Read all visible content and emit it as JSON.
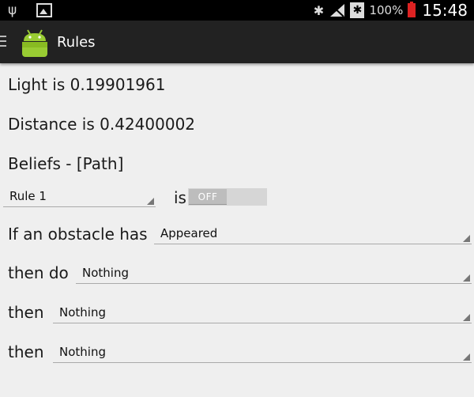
{
  "status_bar": {
    "battery_percent": "100%",
    "time": "15:48"
  },
  "action_bar": {
    "title": "Rules"
  },
  "readings": {
    "light": "Light is 0.19901961",
    "distance": "Distance is 0.42400002",
    "beliefs": "Beliefs - [Path]"
  },
  "rule": {
    "selected": "Rule 1",
    "is_label": "is",
    "toggle_label": "OFF"
  },
  "condition": {
    "label": "If an obstacle has",
    "selected": "Appeared"
  },
  "actions": [
    {
      "label": "then do",
      "selected": "Nothing"
    },
    {
      "label": "then",
      "selected": "Nothing"
    },
    {
      "label": "then",
      "selected": "Nothing"
    }
  ]
}
